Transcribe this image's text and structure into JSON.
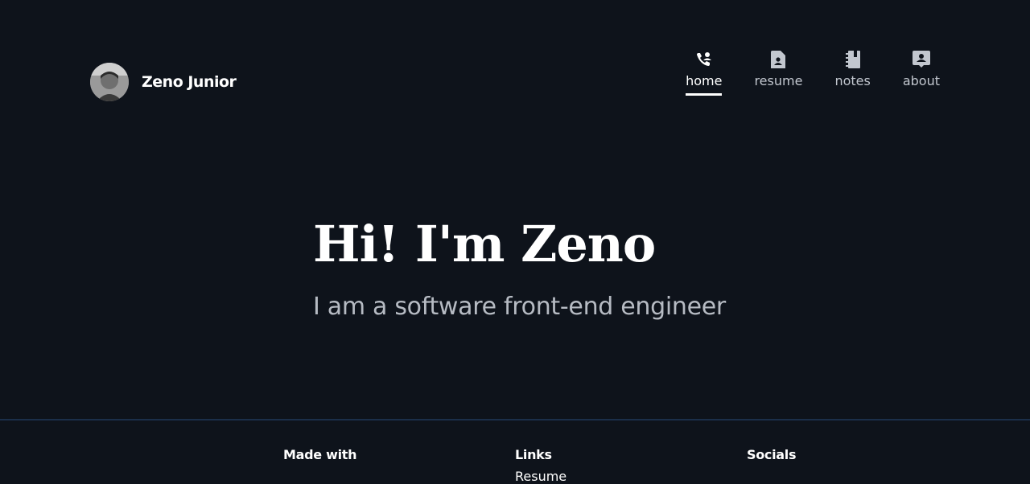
{
  "header": {
    "brand_name": "Zeno Junior",
    "nav": [
      {
        "label": "home",
        "icon": "phone-person-icon",
        "active": true
      },
      {
        "label": "resume",
        "icon": "document-person-icon",
        "active": false
      },
      {
        "label": "notes",
        "icon": "notebook-icon",
        "active": false
      },
      {
        "label": "about",
        "icon": "contact-card-icon",
        "active": false
      }
    ]
  },
  "hero": {
    "title": "Hi! I'm Zeno",
    "subtitle": "I am a software front-end engineer"
  },
  "footer": {
    "made_with": "Made with",
    "links": "Links",
    "links_first": "Resume",
    "socials": "Socials"
  },
  "colors": {
    "background": "#0e131b",
    "divider": "#1b2f4a",
    "text": "#ffffff",
    "muted": "#c2c7cf"
  }
}
